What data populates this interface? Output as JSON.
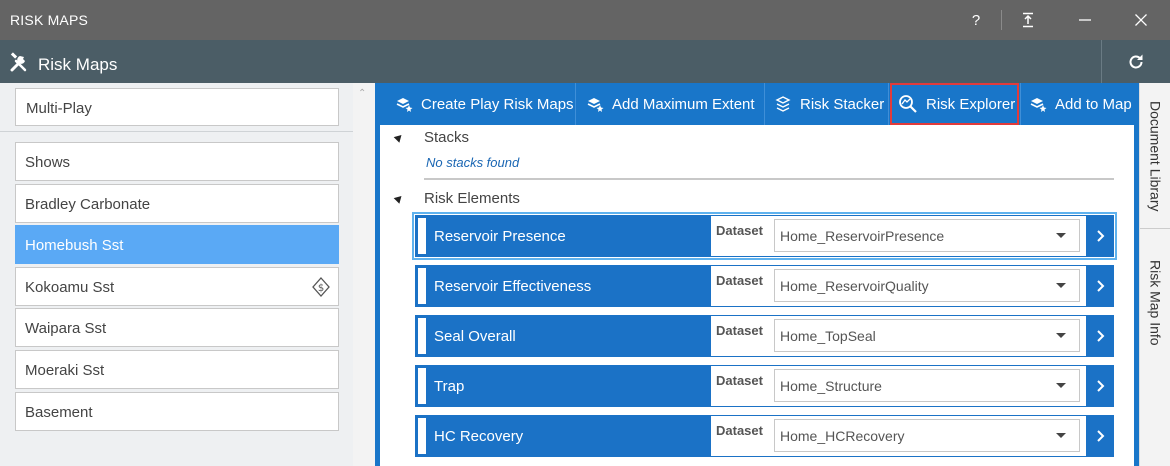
{
  "window": {
    "title": "RISK MAPS",
    "help": "?",
    "pin_icon": "pin-icon",
    "minimize_icon": "minimize-icon",
    "close_icon": "close-icon"
  },
  "header": {
    "title": "Risk Maps",
    "tools_icon": "tools-icon",
    "refresh_icon": "refresh-icon"
  },
  "left_panel": {
    "play_selector": "Multi-Play",
    "items": [
      {
        "label": "Shows",
        "selected": false
      },
      {
        "label": "Bradley Carbonate",
        "selected": false
      },
      {
        "label": "Homebush Sst",
        "selected": true
      },
      {
        "label": "Kokoamu Sst",
        "selected": false,
        "badge_icon": "dollar-diamond-icon"
      },
      {
        "label": "Waipara Sst",
        "selected": false
      },
      {
        "label": "Moeraki Sst",
        "selected": false
      },
      {
        "label": "Basement",
        "selected": false
      }
    ]
  },
  "toolbar": {
    "buttons": [
      {
        "label": "Create Play Risk Maps",
        "icon": "layers-star-icon"
      },
      {
        "label": "Add Maximum Extent",
        "icon": "layers-star-icon"
      },
      {
        "label": "Risk Stacker",
        "icon": "stack-icon"
      },
      {
        "label": "Risk Explorer",
        "icon": "magnifier-map-icon",
        "highlighted": true
      },
      {
        "label": "Add to Map",
        "icon": "layers-star-icon"
      }
    ]
  },
  "stacks": {
    "heading": "Stacks",
    "empty_message": "No stacks found"
  },
  "risk_elements": {
    "heading": "Risk Elements",
    "dataset_label": "Dataset",
    "rows": [
      {
        "name": "Reservoir Presence",
        "dataset": "Home_ReservoirPresence"
      },
      {
        "name": "Reservoir Effectiveness",
        "dataset": "Home_ReservoirQuality"
      },
      {
        "name": "Seal Overall",
        "dataset": "Home_TopSeal"
      },
      {
        "name": "Trap",
        "dataset": "Home_Structure"
      },
      {
        "name": "HC Recovery",
        "dataset": "Home_HCRecovery"
      }
    ]
  },
  "side_tabs": {
    "document_library": "Document Library",
    "risk_map_info": "Risk Map Info"
  },
  "colors": {
    "titlebar": "#646464",
    "header": "#4b5d66",
    "accent_blue": "#1976c9",
    "selected_item": "#5aa9f5",
    "highlight_red": "#e23b3b"
  }
}
